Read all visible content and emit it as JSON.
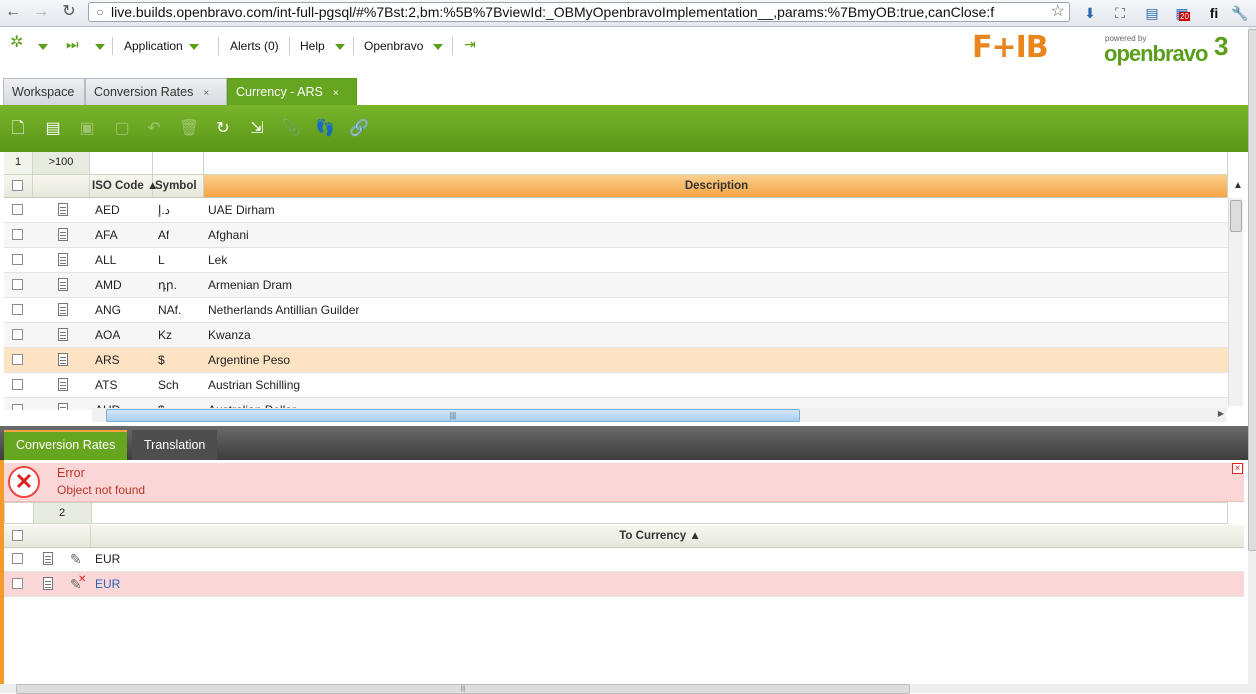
{
  "browser": {
    "url_text": "live.builds.openbravo.com/int-full-pgsql/#%7Bst:2,bm:%5B%7BviewId:_OBMyOpenbravoImplementation__,params:%7BmyOB:true,canClose:f",
    "ext_badge": "20",
    "ext_label": "fi"
  },
  "topnav": {
    "application": "Application",
    "alerts": "Alerts (0)",
    "help": "Help",
    "openbravo": "Openbravo",
    "logo_left": "F+IB",
    "logo_powered": "powered by",
    "logo_brand": "openbravo",
    "logo_version": "3"
  },
  "tabs": [
    {
      "label": "Workspace"
    },
    {
      "label": "Conversion Rates",
      "close": "×"
    },
    {
      "label": "Currency - ARS",
      "close": "×"
    }
  ],
  "grid": {
    "filter_count": "1",
    "filter_total": ">100",
    "headers": {
      "iso": "ISO Code ▲",
      "symbol": "Symbol",
      "description": "Description"
    },
    "rows": [
      {
        "iso": "AED",
        "symbol": "د.إ",
        "description": "UAE Dirham"
      },
      {
        "iso": "AFA",
        "symbol": "Af",
        "description": "Afghani"
      },
      {
        "iso": "ALL",
        "symbol": "L",
        "description": "Lek"
      },
      {
        "iso": "AMD",
        "symbol": "դր.",
        "description": "Armenian Dram"
      },
      {
        "iso": "ANG",
        "symbol": "NAf.",
        "description": "Netherlands Antillian Guilder"
      },
      {
        "iso": "AOA",
        "symbol": "Kz",
        "description": "Kwanza"
      },
      {
        "iso": "ARS",
        "symbol": "$",
        "description": "Argentine Peso"
      },
      {
        "iso": "ATS",
        "symbol": "Sch",
        "description": "Austrian Schilling"
      },
      {
        "iso": "AUD",
        "symbol": "$",
        "description": "Australian Dollar"
      }
    ],
    "scroll_grip": "|||"
  },
  "subtabs": [
    {
      "label": "Conversion Rates"
    },
    {
      "label": "Translation"
    }
  ],
  "error": {
    "title": "Error",
    "message": "Object not found"
  },
  "child_grid": {
    "filter_count": "2",
    "header_to_currency": "To Currency ▲",
    "rows": [
      {
        "to_currency": "EUR"
      },
      {
        "to_currency": "EUR"
      }
    ]
  },
  "colors": {
    "toolbar_green": "#66a51f",
    "selected_header": "#f6a544",
    "selected_row": "#fde2c3",
    "error_bg": "#fbd6d6",
    "error_text": "#b7382a"
  }
}
